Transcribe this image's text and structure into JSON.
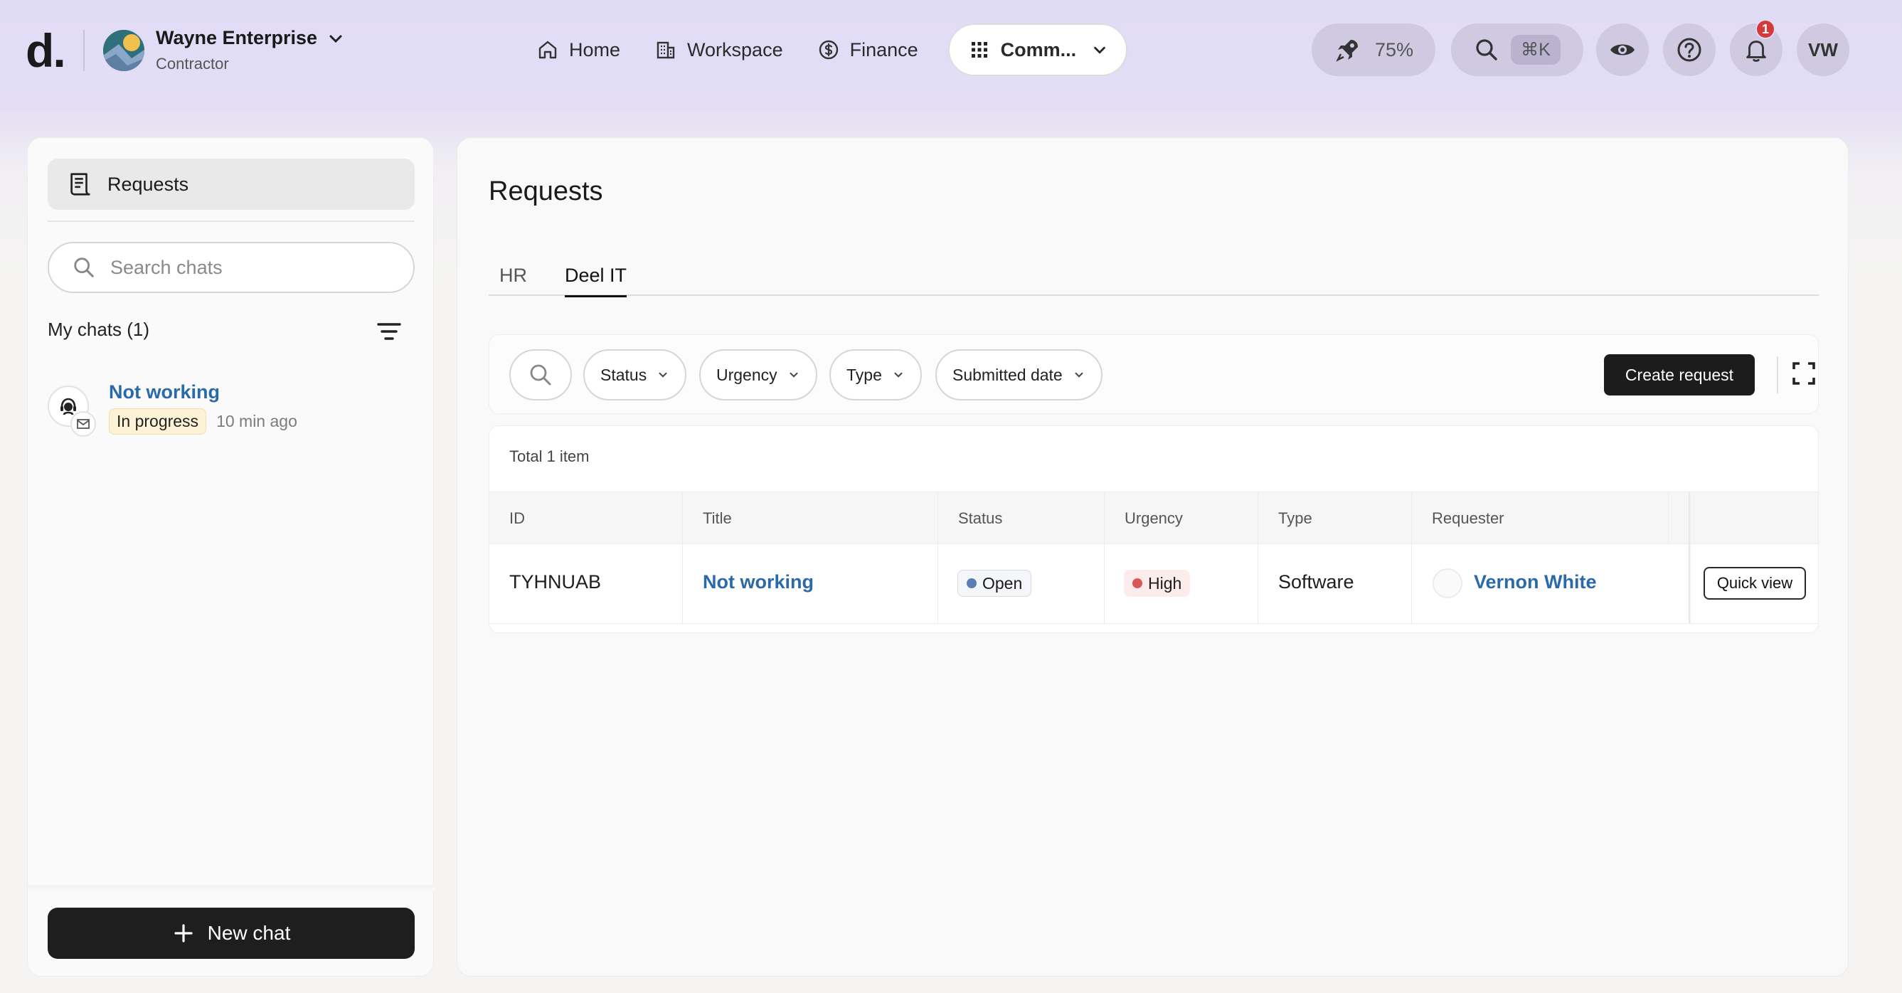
{
  "header": {
    "logo": "d.",
    "org": {
      "name": "Wayne Enterprise",
      "role": "Contractor"
    },
    "nav": [
      {
        "label": "Home",
        "icon": "home-icon"
      },
      {
        "label": "Workspace",
        "icon": "building-icon"
      },
      {
        "label": "Finance",
        "icon": "dollar-icon"
      },
      {
        "label": "Comm...",
        "icon": "grid-icon"
      }
    ],
    "progress_label": "75%",
    "progress": 0.75,
    "search_shortcut": "⌘K",
    "notifications_count": "1",
    "user_initials": "VW"
  },
  "sidebar": {
    "title": "Requests",
    "search_placeholder": "Search chats",
    "my_chats_label": "My chats (1)",
    "chats": [
      {
        "title": "Not working",
        "status": "In progress",
        "time": "10 min ago"
      }
    ],
    "new_chat_label": "New chat"
  },
  "main": {
    "title": "Requests",
    "tabs": [
      {
        "label": "HR"
      },
      {
        "label": "Deel IT",
        "active": true
      }
    ],
    "filters": [
      "Status",
      "Urgency",
      "Type",
      "Submitted date"
    ],
    "create_label": "Create request",
    "total_label": "Total 1 item",
    "columns": [
      "ID",
      "Title",
      "Status",
      "Urgency",
      "Type",
      "Requester"
    ],
    "rows": [
      {
        "id": "TYHNUAB",
        "title": "Not working",
        "status": "Open",
        "urgency": "High",
        "type": "Software",
        "requester": "Vernon White",
        "action": "Quick view"
      }
    ]
  },
  "colors": {
    "accent_link": "#2b6aa8",
    "header_bg": "#e1dcf6",
    "status_open_dot": "#5b7fb5",
    "urgency_high_dot": "#d95757",
    "badge_red": "#d53a3a"
  }
}
